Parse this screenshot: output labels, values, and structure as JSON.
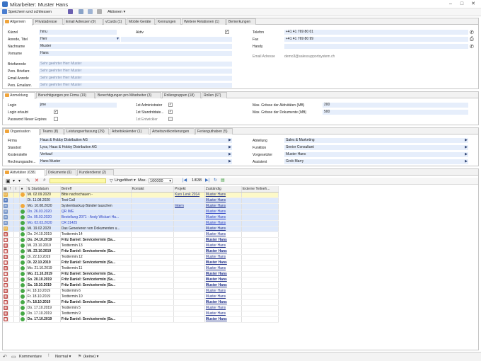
{
  "window": {
    "title": "Mitarbeiter: Muster Hans"
  },
  "toolbar": {
    "save_close": "Speichern und schliessen",
    "actions": "Aktionen"
  },
  "colors": {
    "field_bg": "#e6eefb",
    "highlight": "#fdf9c8",
    "link": "#3044c2",
    "tab_orange": "#f0a43a"
  },
  "top_tabs": [
    "Allgemein",
    "Privatadresse",
    "Email Adressen (9)",
    "vCards (1)",
    "Mobile Geräte",
    "Kennungen",
    "Weitere Relationen (1)",
    "Bemerkungen"
  ],
  "general": {
    "kuerzel_label": "Kürzel",
    "kuerzel": "hmu",
    "aktiv_label": "Aktiv",
    "anrede_label": "Anrede, Titel",
    "anrede": "Herr",
    "nachname_label": "Nachname",
    "nachname": "Muster",
    "vorname_label": "Vorname",
    "vorname": "Hans",
    "briefanrede_label": "Briefanrede",
    "briefanrede": "Sehr geehrter Herr Muster",
    "pers_brief_label": "Pers. Briefanr.",
    "pers_brief": "Sehr geehrter Herr Muster",
    "email_anrede_label": "Email Anrede",
    "email_anrede": "Sehr geehrter Herr Muster",
    "pers_email_label": "Pers. Emailanr.",
    "pers_email": "Sehr geehrter Herr Muster",
    "telefon_label": "Telefon",
    "telefon": "+41 41 769 80 01",
    "fax_label": "Fax",
    "fax": "+41 41 769 80 99",
    "handy_label": "Handy",
    "handy": "",
    "email_label": "Email Adresse",
    "email": "demo3@salessupportsystem.ch"
  },
  "login_tabs": [
    "Anmeldung",
    "Berechtigungen pro Firma (19)",
    "Berechtigungen pro Mitarbeiter (3)",
    "Rollengruppen (18)",
    "Rollen (67)"
  ],
  "login": {
    "login_label": "Login",
    "login": "jme",
    "login_allowed_label": "Login erlaubt",
    "pw_never_label": "Password Never Expires",
    "admin_label": "1st Administrator",
    "standard_label": "1st Standrddate...",
    "dev_label": "1st Entwickler",
    "max_act_label": "Max. Grösse der Aktivitäten (MB)",
    "max_act": "200",
    "max_doc_label": "Max. Grösse der Dokumente (MB)",
    "max_doc": "500"
  },
  "org_tabs": [
    "Organisation",
    "Teams (8)",
    "Leistungserfassung (29)",
    "Arbeitskalender (1)",
    "Arbeitszeitkontierungen",
    "Ferienguthaben (5)"
  ],
  "org": {
    "firma_label": "Firma",
    "firma": "Haus & Hobby Distribution AG",
    "standort_label": "Standort",
    "standort": "Lyss, Haus & Hobby Distribution AG",
    "kst_label": "Kostenstelle",
    "kst": "Verkauf",
    "rech_label": "Rechnungsadre...",
    "rech": "Hans Muster",
    "abteilung_label": "Abteilung",
    "abteilung": "Sales & Marketing",
    "funktion_label": "Funktion",
    "funktion": "Senior Consultant",
    "vorgesetzter_label": "Vorgesetzter",
    "vorgesetzter": "Muster Hans",
    "assistent_label": "Assistent",
    "assistent": "Grob Marry"
  },
  "act_tabs": [
    "Aktivitäten (638)",
    "Dokumente (6)",
    "Kundendienst (2)"
  ],
  "act_toolbar": {
    "filter": "Ungefiltert",
    "max_label": "Max.",
    "max": "100000",
    "pager": "1/638"
  },
  "columns": [
    "Startdatum",
    "Betreff",
    "Kontakt",
    "Projekt",
    "Zuständig",
    "Externe Teilneh..."
  ],
  "rows": [
    {
      "icon": "task",
      "status": "#f2a93b",
      "date": "Mi. 02.09.2020",
      "subject": "Bitte nachschauen -",
      "contact": "",
      "project": "Kurs Lenk 2014",
      "owner": "Muster Hans",
      "cls": "yellow"
    },
    {
      "icon": "phone",
      "status": "",
      "date": "Di. 11.08.2020",
      "subject": "Test Call",
      "contact": "",
      "project": "",
      "owner": "Muster Hans",
      "cls": "sel"
    },
    {
      "icon": "mail",
      "status": "#f2a93b",
      "date": "Mo. 10.08.2020",
      "subject": "Systembackup Bänder tauschen",
      "contact": "",
      "project": "Intern",
      "owner": "Muster Hans",
      "cls": "sel"
    },
    {
      "icon": "mail",
      "status": "#46a846",
      "date": "Do. 26.03.2020",
      "subject": "QR IME",
      "contact": "",
      "project": "",
      "owner": "Muster Hans",
      "cls": "sel blue"
    },
    {
      "icon": "mail",
      "status": "#46a846",
      "date": "Do. 05.03.2020",
      "subject": "Bestellung 2071 - Andy Wickart Ha...",
      "contact": "",
      "project": "",
      "owner": "Muster Hans",
      "cls": "sel blue"
    },
    {
      "icon": "mail",
      "status": "#46a846",
      "date": "Mo. 02.03.2020",
      "subject": "CR 31425",
      "contact": "",
      "project": "",
      "owner": "Muster Hans",
      "cls": "sel blue"
    },
    {
      "icon": "task",
      "status": "#46a846",
      "date": "Mi. 19.02.2020",
      "subject": "Das Generieren von Dokumenten u...",
      "contact": "",
      "project": "",
      "owner": "Muster Hans",
      "cls": "sel"
    },
    {
      "icon": "cal",
      "status": "#46a846",
      "date": "Do. 24.10.2019",
      "subject": "Testtermin 14",
      "contact": "",
      "project": "",
      "owner": "Muster Hans",
      "cls": ""
    },
    {
      "icon": "cal",
      "status": "#46a846",
      "date": "Do. 24.10.2019",
      "subject": "Fritz Daniel: Servicetermin (Sa...",
      "contact": "",
      "project": "",
      "owner": "Muster Hans",
      "cls": "bold"
    },
    {
      "icon": "cal",
      "status": "#46a846",
      "date": "Mi. 23.10.2019",
      "subject": "Testtermin 13",
      "contact": "",
      "project": "",
      "owner": "Muster Hans",
      "cls": ""
    },
    {
      "icon": "cal",
      "status": "#46a846",
      "date": "Mi. 23.10.2019",
      "subject": "Fritz Daniel: Servicetermin (Sa...",
      "contact": "",
      "project": "",
      "owner": "Muster Hans",
      "cls": "bold"
    },
    {
      "icon": "cal",
      "status": "#46a846",
      "date": "Di. 22.10.2019",
      "subject": "Testtermin 12",
      "contact": "",
      "project": "",
      "owner": "Muster Hans",
      "cls": ""
    },
    {
      "icon": "cal",
      "status": "#46a846",
      "date": "Di. 22.10.2019",
      "subject": "Fritz Daniel: Servicetermin (Sa...",
      "contact": "",
      "project": "",
      "owner": "Muster Hans",
      "cls": "bold"
    },
    {
      "icon": "cal",
      "status": "#46a846",
      "date": "Mo. 21.10.2019",
      "subject": "Testtermin 11",
      "contact": "",
      "project": "",
      "owner": "Muster Hans",
      "cls": ""
    },
    {
      "icon": "cal",
      "status": "#46a846",
      "date": "Mo. 21.10.2019",
      "subject": "Fritz Daniel: Servicetermin (Sa...",
      "contact": "",
      "project": "",
      "owner": "Muster Hans",
      "cls": "bold"
    },
    {
      "icon": "cal",
      "status": "#46a846",
      "date": "So. 20.10.2019",
      "subject": "Fritz Daniel: Servicetermin (Sa...",
      "contact": "",
      "project": "",
      "owner": "Muster Hans",
      "cls": "bold"
    },
    {
      "icon": "cal",
      "status": "#46a846",
      "date": "Sa. 19.10.2019",
      "subject": "Fritz Daniel: Servicetermin (Sa...",
      "contact": "",
      "project": "",
      "owner": "Muster Hans",
      "cls": "bold"
    },
    {
      "icon": "cal",
      "status": "#46a846",
      "date": "Fr. 18.10.2019",
      "subject": "Testtermin 6",
      "contact": "",
      "project": "",
      "owner": "Muster Hans",
      "cls": ""
    },
    {
      "icon": "cal",
      "status": "#46a846",
      "date": "Fr. 18.10.2019",
      "subject": "Testtermin 10",
      "contact": "",
      "project": "",
      "owner": "Muster Hans",
      "cls": ""
    },
    {
      "icon": "cal",
      "status": "#46a846",
      "date": "Fr. 18.10.2019",
      "subject": "Fritz Daniel: Servicetermin (Sa...",
      "contact": "",
      "project": "",
      "owner": "Muster Hans",
      "cls": "bold"
    },
    {
      "icon": "cal",
      "status": "#46a846",
      "date": "Do. 17.10.2019",
      "subject": "Testtermin 5",
      "contact": "",
      "project": "",
      "owner": "Muster Hans",
      "cls": ""
    },
    {
      "icon": "cal",
      "status": "#46a846",
      "date": "Do. 17.10.2019",
      "subject": "Testtermin 9",
      "contact": "",
      "project": "",
      "owner": "Muster Hans",
      "cls": ""
    },
    {
      "icon": "cal",
      "status": "#46a846",
      "date": "Do. 17.10.2019",
      "subject": "Fritz Daniel: Servicetermin (Sa...",
      "contact": "",
      "project": "",
      "owner": "Muster Hans",
      "cls": "bold"
    }
  ],
  "statusbar": {
    "comments": "Kommentare",
    "priority": "Normal",
    "flag": "(keine)"
  }
}
